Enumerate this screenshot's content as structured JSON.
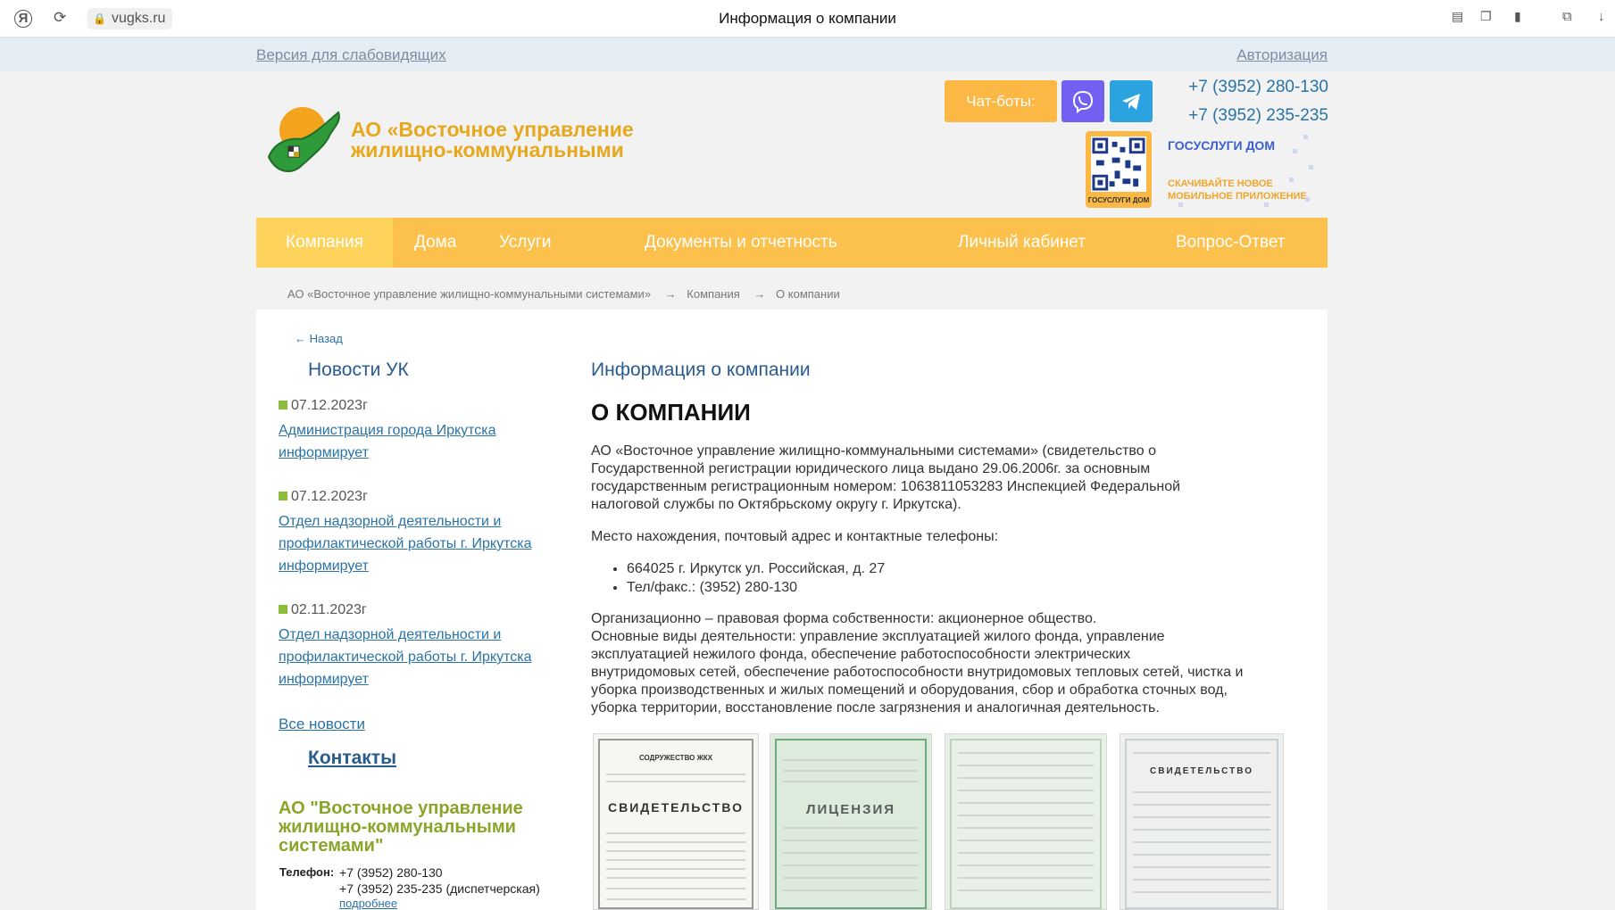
{
  "browser": {
    "brand_glyph": "Я",
    "url": "vugks.ru",
    "page_title": "Информация о компании"
  },
  "top_strip": {
    "accessibility_link": "Версия для слабовидящих",
    "login_link": "Авторизация"
  },
  "header": {
    "logo_line1": "АО «Восточное управление",
    "logo_line2": "жилищно-коммунальными",
    "chatbots_label": "Чат-боты:",
    "phone1": "+7 (3952) 280-130",
    "phone2": "+7 (3952) 235-235",
    "gosuslugi_title": "ГОСУСЛУГИ ДОМ",
    "gosuslugi_promo_line1": "СКАЧИВАЙТЕ НОВОЕ",
    "gosuslugi_promo_line2": "МОБИЛЬНОЕ ПРИЛОЖЕНИЕ",
    "qr_caption": "ГОСУСЛУГИ ДОМ"
  },
  "nav": {
    "items": [
      "Компания",
      "Дома",
      "Услуги",
      "Документы и отчетность",
      "Личный кабинет",
      "Вопрос-Ответ"
    ]
  },
  "breadcrumb": {
    "items": [
      "АО «Восточное управление жилищно-коммунальными системами»",
      "Компания",
      "О компании"
    ],
    "separator": "→"
  },
  "sidebar": {
    "back": "← Назад",
    "news_title": "Новости УК",
    "news": [
      {
        "date": "07.12.2023г",
        "title_line1": "Администрация города Иркутска",
        "title_line2": "информирует",
        "title_line3": ""
      },
      {
        "date": "07.12.2023г",
        "title_line1": "Отдел надзорной деятельности и",
        "title_line2": "профилактической работы г. Иркутска",
        "title_line3": "информирует"
      },
      {
        "date": "02.11.2023г",
        "title_line1": "Отдел надзорной деятельности и",
        "title_line2": "профилактической работы г. Иркутска",
        "title_line3": "информирует"
      }
    ],
    "all_news": "Все новости",
    "contacts_title": "Контакты",
    "org_name": "АО \"Восточное управление жилищно-коммунальными системами\"",
    "phone_label": "Телефон:",
    "phone1": "+7 (3952) 280-130",
    "phone2": "+7 (3952) 235-235 (диспетчерская)",
    "more": "подробнее"
  },
  "main": {
    "section_title": "Информация о компании",
    "heading": "О КОМПАНИИ",
    "p1_l1": "АО «Восточное управление жилищно-коммунальными системами» (свидетельство о",
    "p1_l2": "Государственной регистрации юридического лица выдано 29.06.2006г. за основным",
    "p1_l3": "государственным регистрационным номером: 1063811053283 Инспекцией Федеральной",
    "p1_l4": "налоговой службы по Октябрьскому округу г. Иркутска).",
    "p2": "Место нахождения, почтовый адрес и контактные телефоны:",
    "address": "664025 г. Иркутск ул. Российская, д. 27",
    "phone_fax": "Тел/факс.: (3952) 280-130",
    "p3_l1": "Организационно – правовая форма собственности: акционерное общество.",
    "p3_l2": "Основные виды деятельности: управление эксплуатацией жилого фонда, управление",
    "p3_l3": "эксплуатацией нежилого фонда, обеспечение работоспособности электрических",
    "p3_l4": "внутридомовых сетей, обеспечение работоспособности внутридомовых тепловых сетей, чистка и",
    "p3_l5": "уборка производственных и жилых помещений и оборудования, сбор и обработка сточных вод,",
    "p3_l6": "уборка территории, восстановление после загрязнения и аналогичная деятельность.",
    "certificates": [
      {
        "org": "СОДРУЖЕСТВО ЖКХ",
        "caption": "СВИДЕТЕЛЬСТВО"
      },
      {
        "org": "",
        "caption": "ЛИЦЕНЗИЯ"
      },
      {
        "org": "",
        "caption": ""
      },
      {
        "org": "",
        "caption": "СВИДЕТЕЛЬСТВО"
      }
    ]
  },
  "colors": {
    "accent_orange": "#fcc14c",
    "link_blue": "#2a73a6",
    "heading_blue": "#2a5b8e",
    "org_green": "#8aa52a",
    "viber": "#7360f2",
    "telegram": "#2aa3e0"
  }
}
